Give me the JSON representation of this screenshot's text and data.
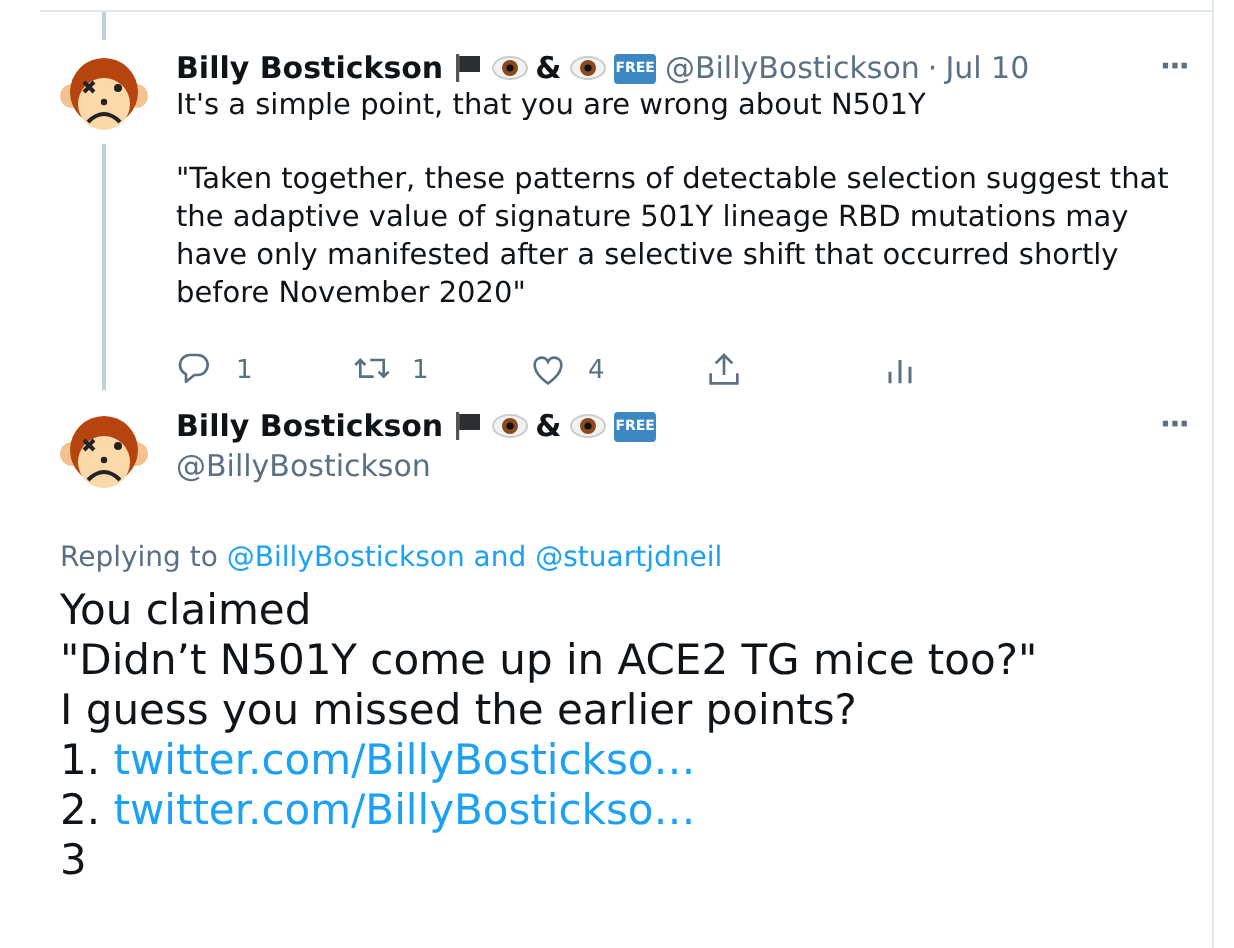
{
  "tweet": {
    "name": "Billy Bostickson",
    "badges": [
      {
        "kind": "flag"
      },
      {
        "kind": "eye"
      },
      {
        "kind": "text",
        "text": "&"
      },
      {
        "kind": "eye"
      },
      {
        "kind": "free",
        "text": "FREE"
      }
    ],
    "handle": "@BillyBostickson",
    "separator": "·",
    "date": "Jul 10",
    "more": "···",
    "paragraphs": [
      "It's a simple point, that you are wrong about N501Y",
      "\"Taken together, these patterns of detectable selection suggest that the adaptive value of signature 501Y lineage RBD mutations may have only manifested after a selective shift that occurred shortly before November 2020\""
    ],
    "actions": [
      {
        "kind": "reply",
        "count": "1"
      },
      {
        "kind": "retweet",
        "count": "1"
      },
      {
        "kind": "like",
        "count": "4"
      },
      {
        "kind": "share"
      },
      {
        "kind": "analytics"
      }
    ]
  },
  "reply": {
    "name": "Billy Bostickson",
    "badges": [
      {
        "kind": "flag"
      },
      {
        "kind": "eye"
      },
      {
        "kind": "text",
        "text": "&"
      },
      {
        "kind": "eye"
      },
      {
        "kind": "free",
        "text": "FREE"
      }
    ],
    "handle": "@BillyBostickson",
    "more": "···",
    "replying_to": {
      "label": "Replying to",
      "mentions": [
        "@BillyBostickson",
        "@stuartjdneil"
      ],
      "joiner": "and"
    },
    "lines": [
      {
        "kind": "text",
        "text": "You claimed"
      },
      {
        "kind": "text",
        "text": "\"Didn’t N501Y come up in ACE2 TG mice too?\""
      },
      {
        "kind": "text",
        "text": "I guess you missed the earlier points?"
      },
      {
        "kind": "link",
        "number": "1.",
        "url": "twitter.com/BillyBostickso…"
      },
      {
        "kind": "link",
        "number": "2.",
        "url": "twitter.com/BillyBostickso…"
      },
      {
        "kind": "text",
        "text": "3"
      }
    ]
  }
}
